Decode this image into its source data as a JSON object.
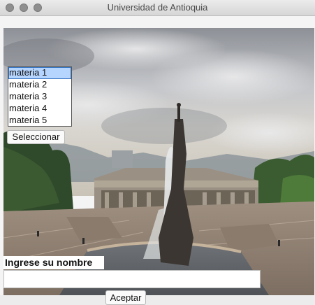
{
  "window": {
    "title": "Universidad de Antioquia",
    "controls": [
      "close-icon",
      "minimize-icon",
      "maximize-icon"
    ]
  },
  "list": {
    "items": [
      "materia 1",
      "materia 2",
      "materia 3",
      "materia 4",
      "materia 5"
    ],
    "selected": "materia 1"
  },
  "buttons": {
    "select_label": "Seleccionar",
    "accept_label": "Aceptar"
  },
  "form": {
    "name_label": "Ingrese su nombre",
    "name_value": ""
  },
  "colors": {
    "selection": "#b5d5ff",
    "selection_border": "#3b78c4"
  }
}
